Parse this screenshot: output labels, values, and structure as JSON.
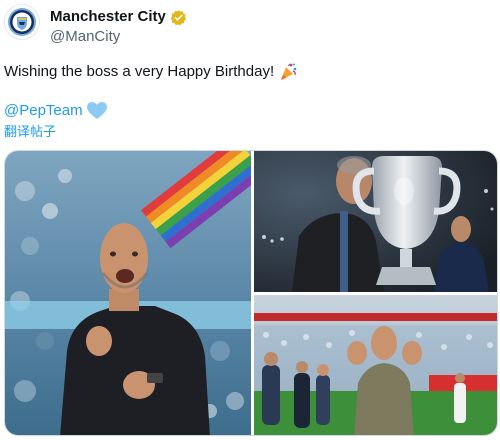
{
  "author": {
    "name": "Manchester City",
    "handle": "@ManCity",
    "avatar_icon": "manchester-city-crest-icon",
    "verified_icon": "gold-verified-badge-icon",
    "verified_color": "#e2b719"
  },
  "tweet": {
    "text": "Wishing the boss a very Happy Birthday!",
    "text_emoji_icon": "party-popper-icon",
    "mention": "@PepTeam",
    "mention_emoji_icon": "light-blue-heart-icon",
    "translate_label": "翻译帖子"
  },
  "media": {
    "photos": [
      {
        "icon": "photo-celebration-icon"
      },
      {
        "icon": "photo-trophy-kiss-icon"
      },
      {
        "icon": "photo-stadium-celebration-icon"
      }
    ]
  },
  "colors": {
    "link": "#1d9bf0",
    "secondary_text": "#536471",
    "city_blue": "#6cabdd",
    "navy": "#1c2c5b"
  }
}
